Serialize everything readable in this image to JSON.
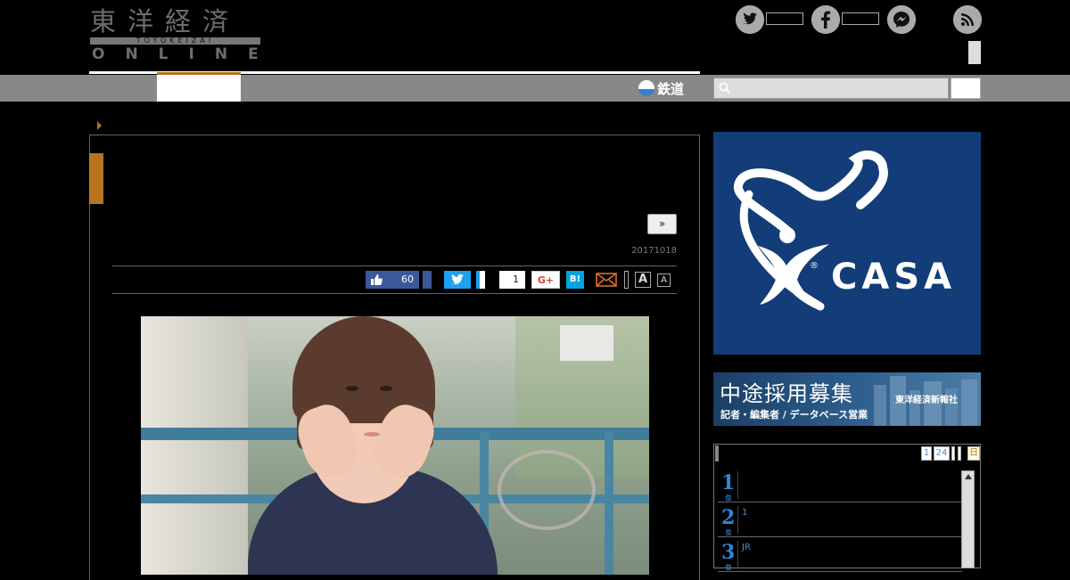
{
  "logo": {
    "kanji": "東洋経済",
    "roman": "TOYOKEIZAI",
    "online": "ONLINE"
  },
  "nav": {
    "rail_label": "鉄道"
  },
  "search": {
    "placeholder": ""
  },
  "article": {
    "next_label": "»",
    "date": "20171018",
    "share": {
      "facebook_like_count": "60",
      "pocket_count": "1",
      "gplus_label": "G+",
      "hatena_label": "B!",
      "font_large_label": "A",
      "font_small_label": "A"
    }
  },
  "sidebar": {
    "ad_casa_text": "CASA",
    "recruit": {
      "title": "中途採用募集",
      "subtitle": "記者・編集者 / データベース営業",
      "company": "東洋経済新報社"
    },
    "ranking": {
      "tabs": [
        "1",
        "24",
        "",
        "",
        "日"
      ],
      "items": [
        {
          "rank": "1",
          "suffix": "位",
          "text": ""
        },
        {
          "rank": "2",
          "suffix": "位",
          "text": "1"
        },
        {
          "rank": "3",
          "suffix": "位",
          "text": "JR"
        }
      ]
    }
  },
  "colors": {
    "accent": "#b7741d",
    "navbar": "#888888",
    "facebook": "#3b5998",
    "twitter": "#1da1f2",
    "hatena": "#00a4de",
    "ranking_blue": "#2f86d4",
    "casa_bg": "#123d78"
  }
}
